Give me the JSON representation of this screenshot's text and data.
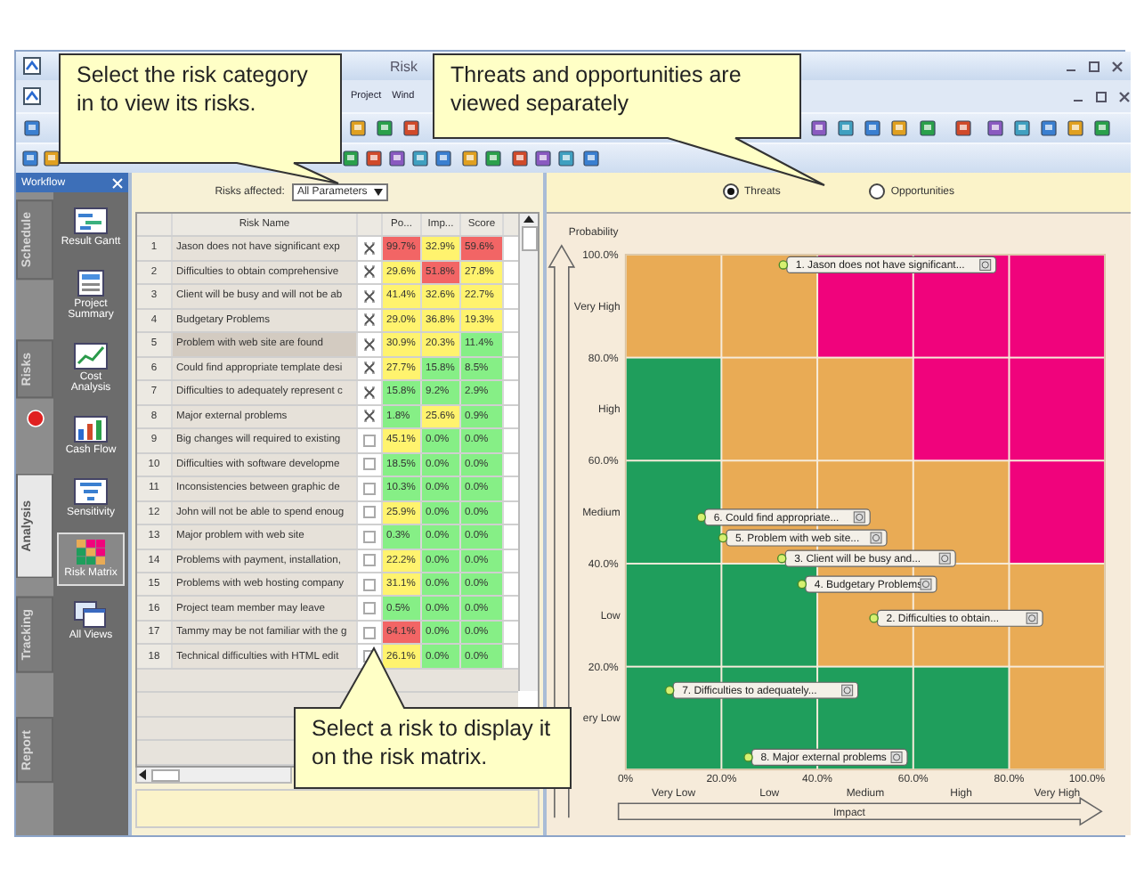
{
  "window": {
    "title": "Risk"
  },
  "menu": [
    "Project",
    "Wind"
  ],
  "workflow": {
    "title": "Workflow",
    "tabs": [
      {
        "label": "Schedule",
        "selected": false
      },
      {
        "label": "Risks",
        "selected": false
      },
      {
        "label": "Analysis",
        "selected": true
      },
      {
        "label": "Tracking",
        "selected": false
      },
      {
        "label": "Report",
        "selected": false
      }
    ],
    "items": [
      {
        "label": "Result Gantt",
        "selected": false
      },
      {
        "label": "Project Summary",
        "selected": false
      },
      {
        "label": "Cost Analysis",
        "selected": false
      },
      {
        "label": "Cash Flow",
        "selected": false
      },
      {
        "label": "Sensitivity",
        "selected": false
      },
      {
        "label": "Risk Matrix",
        "selected": true
      },
      {
        "label": "All Views",
        "selected": false
      }
    ]
  },
  "risk_table": {
    "filter_label": "Risks affected:",
    "filter_value": "All Parameters",
    "columns": [
      "Risk Name",
      "Po...",
      "Imp...",
      "Score"
    ],
    "rows": [
      {
        "number": "1",
        "name": "Jason does not have significant exp",
        "checked": true,
        "selected": false,
        "probability": {
          "text": "99.7%",
          "kind": "high"
        },
        "impact": {
          "text": "32.9%",
          "kind": "medium"
        },
        "score": {
          "text": "59.6%",
          "kind": "high"
        }
      },
      {
        "number": "2",
        "name": "Difficulties to obtain comprehensive",
        "checked": true,
        "selected": false,
        "probability": {
          "text": "29.6%",
          "kind": "medium"
        },
        "impact": {
          "text": "51.8%",
          "kind": "high"
        },
        "score": {
          "text": "27.8%",
          "kind": "medium"
        }
      },
      {
        "number": "3",
        "name": "Client will be busy and will not be ab",
        "checked": true,
        "selected": false,
        "probability": {
          "text": "41.4%",
          "kind": "medium"
        },
        "impact": {
          "text": "32.6%",
          "kind": "medium"
        },
        "score": {
          "text": "22.7%",
          "kind": "medium"
        }
      },
      {
        "number": "4",
        "name": "Budgetary Problems",
        "checked": true,
        "selected": false,
        "probability": {
          "text": "29.0%",
          "kind": "medium"
        },
        "impact": {
          "text": "36.8%",
          "kind": "medium"
        },
        "score": {
          "text": "19.3%",
          "kind": "medium"
        }
      },
      {
        "number": "5",
        "name": "Problem with web site are found",
        "checked": true,
        "selected": true,
        "probability": {
          "text": "30.9%",
          "kind": "medium"
        },
        "impact": {
          "text": "20.3%",
          "kind": "medium"
        },
        "score": {
          "text": "11.4%",
          "kind": "low"
        }
      },
      {
        "number": "6",
        "name": "Could find appropriate template desi",
        "checked": true,
        "selected": false,
        "probability": {
          "text": "27.7%",
          "kind": "medium"
        },
        "impact": {
          "text": "15.8%",
          "kind": "low"
        },
        "score": {
          "text": "8.5%",
          "kind": "low"
        }
      },
      {
        "number": "7",
        "name": "Difficulties to adequately represent c",
        "checked": true,
        "selected": false,
        "probability": {
          "text": "15.8%",
          "kind": "low"
        },
        "impact": {
          "text": "9.2%",
          "kind": "low"
        },
        "score": {
          "text": "2.9%",
          "kind": "low"
        }
      },
      {
        "number": "8",
        "name": "Major external problems",
        "checked": true,
        "selected": false,
        "probability": {
          "text": "1.8%",
          "kind": "low"
        },
        "impact": {
          "text": "25.6%",
          "kind": "medium"
        },
        "score": {
          "text": "0.9%",
          "kind": "low"
        }
      },
      {
        "number": "9",
        "name": "Big changes will required to existing",
        "checked": false,
        "selected": false,
        "probability": {
          "text": "45.1%",
          "kind": "medium"
        },
        "impact": {
          "text": "0.0%",
          "kind": "low"
        },
        "score": {
          "text": "0.0%",
          "kind": "low"
        }
      },
      {
        "number": "10",
        "name": "Difficulties with software developme",
        "checked": false,
        "selected": false,
        "probability": {
          "text": "18.5%",
          "kind": "low"
        },
        "impact": {
          "text": "0.0%",
          "kind": "low"
        },
        "score": {
          "text": "0.0%",
          "kind": "low"
        }
      },
      {
        "number": "11",
        "name": "Inconsistencies between graphic de",
        "checked": false,
        "selected": false,
        "probability": {
          "text": "10.3%",
          "kind": "low"
        },
        "impact": {
          "text": "0.0%",
          "kind": "low"
        },
        "score": {
          "text": "0.0%",
          "kind": "low"
        }
      },
      {
        "number": "12",
        "name": "John will not be able to spend enoug",
        "checked": false,
        "selected": false,
        "probability": {
          "text": "25.9%",
          "kind": "medium"
        },
        "impact": {
          "text": "0.0%",
          "kind": "low"
        },
        "score": {
          "text": "0.0%",
          "kind": "low"
        }
      },
      {
        "number": "13",
        "name": "Major problem with web site",
        "checked": false,
        "selected": false,
        "probability": {
          "text": "0.3%",
          "kind": "low"
        },
        "impact": {
          "text": "0.0%",
          "kind": "low"
        },
        "score": {
          "text": "0.0%",
          "kind": "low"
        }
      },
      {
        "number": "14",
        "name": "Problems with payment, installation,",
        "checked": false,
        "selected": false,
        "probability": {
          "text": "22.2%",
          "kind": "medium"
        },
        "impact": {
          "text": "0.0%",
          "kind": "low"
        },
        "score": {
          "text": "0.0%",
          "kind": "low"
        }
      },
      {
        "number": "15",
        "name": "Problems with web hosting company",
        "checked": false,
        "selected": false,
        "probability": {
          "text": "31.1%",
          "kind": "medium"
        },
        "impact": {
          "text": "0.0%",
          "kind": "low"
        },
        "score": {
          "text": "0.0%",
          "kind": "low"
        }
      },
      {
        "number": "16",
        "name": "Project team member may leave",
        "checked": false,
        "selected": false,
        "probability": {
          "text": "0.5%",
          "kind": "low"
        },
        "impact": {
          "text": "0.0%",
          "kind": "low"
        },
        "score": {
          "text": "0.0%",
          "kind": "low"
        }
      },
      {
        "number": "17",
        "name": "Tammy may be not familiar with the g",
        "checked": false,
        "selected": false,
        "probability": {
          "text": "64.1%",
          "kind": "high"
        },
        "impact": {
          "text": "0.0%",
          "kind": "low"
        },
        "score": {
          "text": "0.0%",
          "kind": "low"
        }
      },
      {
        "number": "18",
        "name": "Technical difficulties with HTML edit",
        "checked": false,
        "selected": false,
        "probability": {
          "text": "26.1%",
          "kind": "medium"
        },
        "impact": {
          "text": "0.0%",
          "kind": "low"
        },
        "score": {
          "text": "0.0%",
          "kind": "low"
        }
      }
    ]
  },
  "risk_matrix": {
    "options": [
      {
        "label": "Threats",
        "selected": true
      },
      {
        "label": "Opportunities",
        "selected": false
      }
    ],
    "zones": [
      {
        "cells": [
          {
            "kind": "medium"
          },
          {
            "kind": "medium"
          },
          {
            "kind": "high"
          },
          {
            "kind": "high"
          },
          {
            "kind": "high"
          }
        ]
      },
      {
        "cells": [
          {
            "kind": "low"
          },
          {
            "kind": "medium"
          },
          {
            "kind": "medium"
          },
          {
            "kind": "high"
          },
          {
            "kind": "high"
          }
        ]
      },
      {
        "cells": [
          {
            "kind": "low"
          },
          {
            "kind": "medium"
          },
          {
            "kind": "medium"
          },
          {
            "kind": "medium"
          },
          {
            "kind": "high"
          }
        ]
      },
      {
        "cells": [
          {
            "kind": "low"
          },
          {
            "kind": "low"
          },
          {
            "kind": "medium"
          },
          {
            "kind": "medium"
          },
          {
            "kind": "medium"
          }
        ]
      },
      {
        "cells": [
          {
            "kind": "low"
          },
          {
            "kind": "low"
          },
          {
            "kind": "low"
          },
          {
            "kind": "low"
          },
          {
            "kind": "medium"
          }
        ]
      }
    ],
    "y_bands": [
      "Very High",
      "High",
      "Medium",
      "Low",
      "ery Low"
    ],
    "x_bands": [
      "Very Low",
      "Low",
      "Medium",
      "High",
      "Very High"
    ],
    "chart_data": {
      "type": "scatter",
      "xlabel": "Impact",
      "ylabel": "Probability",
      "xlim": [
        0,
        100
      ],
      "ylim": [
        0,
        100
      ],
      "xticks": [
        {
          "value": 0,
          "label": "0%"
        },
        {
          "value": 20,
          "label": "20.0%"
        },
        {
          "value": 40,
          "label": "40.0%"
        },
        {
          "value": 60,
          "label": "60.0%"
        },
        {
          "value": 80,
          "label": "80.0%"
        },
        {
          "value": 100,
          "label": "100.0%"
        }
      ],
      "yticks": [
        {
          "value": 20,
          "label": "20.0%"
        },
        {
          "value": 40,
          "label": "40.0%"
        },
        {
          "value": 60,
          "label": "60.0%"
        },
        {
          "value": 80,
          "label": "80.0%"
        },
        {
          "value": 100,
          "label": "100.0%"
        }
      ],
      "series": [
        {
          "name": "1. Jason does not have significant...",
          "x": [
            32.9
          ],
          "values": [
            98.0
          ]
        },
        {
          "name": "6. Could find appropriate...",
          "x": [
            15.8
          ],
          "values": [
            49.0
          ]
        },
        {
          "name": "5. Problem with web site...",
          "x": [
            20.3
          ],
          "values": [
            45.0
          ]
        },
        {
          "name": "3. Client will be busy and...",
          "x": [
            32.6
          ],
          "values": [
            41.0
          ]
        },
        {
          "name": "4. Budgetary Problems",
          "x": [
            36.8
          ],
          "values": [
            36.0
          ]
        },
        {
          "name": "2. Difficulties to obtain...",
          "x": [
            51.8
          ],
          "values": [
            29.4
          ]
        },
        {
          "name": "7. Difficulties to adequately...",
          "x": [
            9.2
          ],
          "values": [
            15.4
          ]
        },
        {
          "name": "8. Major external problems",
          "x": [
            25.6
          ],
          "values": [
            2.4
          ]
        }
      ]
    }
  },
  "callouts": [
    {
      "text": "Select the risk category in to view its risks."
    },
    {
      "text": "Threats and opportunities are viewed separately"
    },
    {
      "text": "Select a risk to display it on the risk matrix."
    }
  ]
}
